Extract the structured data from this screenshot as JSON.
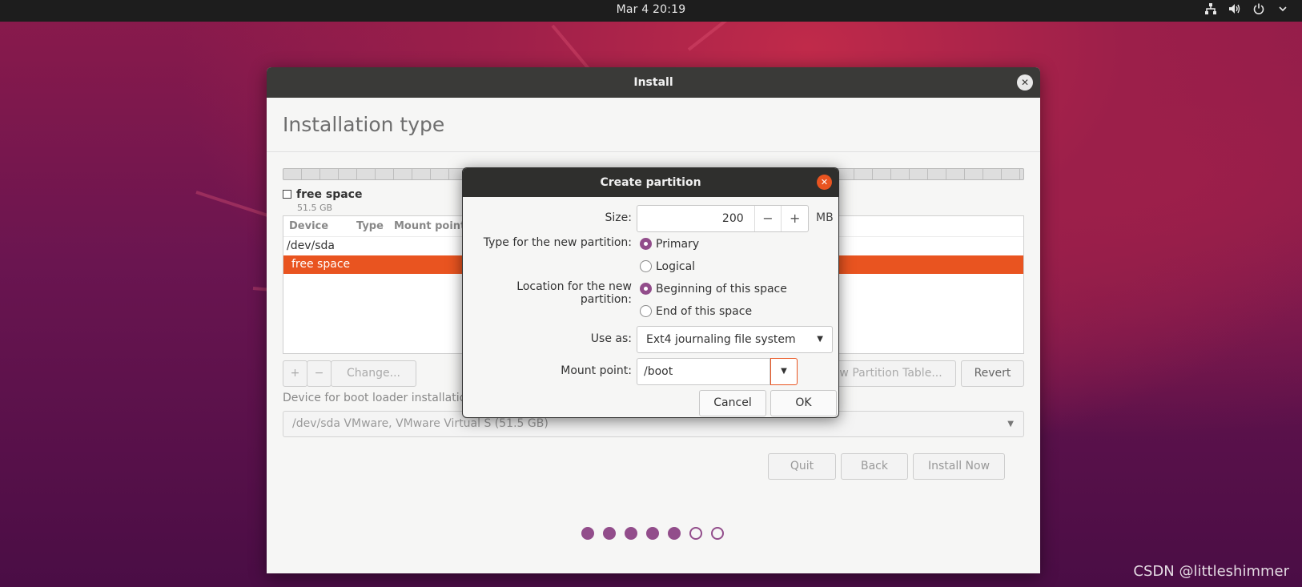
{
  "topbar": {
    "clock": "Mar 4  20:19",
    "tray": [
      "network-icon",
      "volume-icon",
      "power-icon"
    ]
  },
  "window": {
    "title": "Install",
    "page_title": "Installation type",
    "legend": {
      "name": "free space",
      "size": "51.5 GB"
    },
    "table": {
      "columns": [
        "Device",
        "Type",
        "Mount point"
      ],
      "rows": [
        "/dev/sda",
        "free space"
      ]
    },
    "toolbar": {
      "add": "+",
      "remove": "−",
      "change": "Change...",
      "new_table": "New Partition Table...",
      "revert": "Revert"
    },
    "bootloader": {
      "label": "Device for boot loader installation:",
      "value": "/dev/sda VMware, VMware Virtual S (51.5 GB)"
    },
    "nav": {
      "quit": "Quit",
      "back": "Back",
      "install": "Install Now"
    },
    "progress": {
      "total_steps": 7,
      "completed_steps": 5
    }
  },
  "dialog": {
    "title": "Create partition",
    "size_label": "Size:",
    "size_value": "200",
    "size_unit": "MB",
    "type_label": "Type for the new partition:",
    "type_options": [
      "Primary",
      "Logical"
    ],
    "type_selected": "Primary",
    "location_label": "Location for the new partition:",
    "location_options": [
      "Beginning of this space",
      "End of this space"
    ],
    "location_selected": "Beginning of this space",
    "use_as_label": "Use as:",
    "use_as_value": "Ext4 journaling file system",
    "mount_label": "Mount point:",
    "mount_value": "/boot",
    "cancel": "Cancel",
    "ok": "OK"
  },
  "watermark": "CSDN @littleshimmer",
  "colors": {
    "accent": "#e95420",
    "purple": "#924d8b",
    "titlebar": "#3a3a38"
  }
}
